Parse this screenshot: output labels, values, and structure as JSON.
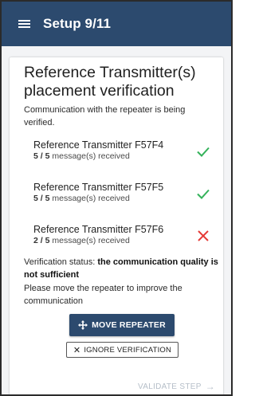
{
  "appbar": {
    "title": "Setup 9/11"
  },
  "card": {
    "title": "Reference Transmitter(s) placement verification",
    "intro": "Communication with the repeater is being verified.",
    "transmitters": [
      {
        "name": "Reference Transmitter F57F4",
        "received": "5 / 5",
        "suffix": " message(s) received",
        "status": "ok"
      },
      {
        "name": "Reference Transmitter F57F5",
        "received": "5 / 5",
        "suffix": " message(s) received",
        "status": "ok"
      },
      {
        "name": "Reference Transmitter F57F6",
        "received": "2 / 5",
        "suffix": " message(s) received",
        "status": "fail"
      }
    ],
    "verification_label": "Verification status: ",
    "verification_value": "the communication quality is not sufficient",
    "instruction": "Please move the repeater to improve the communication"
  },
  "buttons": {
    "move_repeater": "MOVE REPEATER",
    "ignore_verification": "IGNORE VERIFICATION",
    "validate_step": "VALIDATE STEP"
  },
  "icons": {
    "menu": "hamburger-icon",
    "ok": "check-icon",
    "fail": "cross-icon",
    "move": "move-arrows-icon",
    "close": "close-icon",
    "next": "arrow-right-icon"
  },
  "colors": {
    "primary": "#2c4a6e",
    "ok": "#34b25a",
    "fail": "#e53935",
    "disabled": "#b5bec8"
  }
}
